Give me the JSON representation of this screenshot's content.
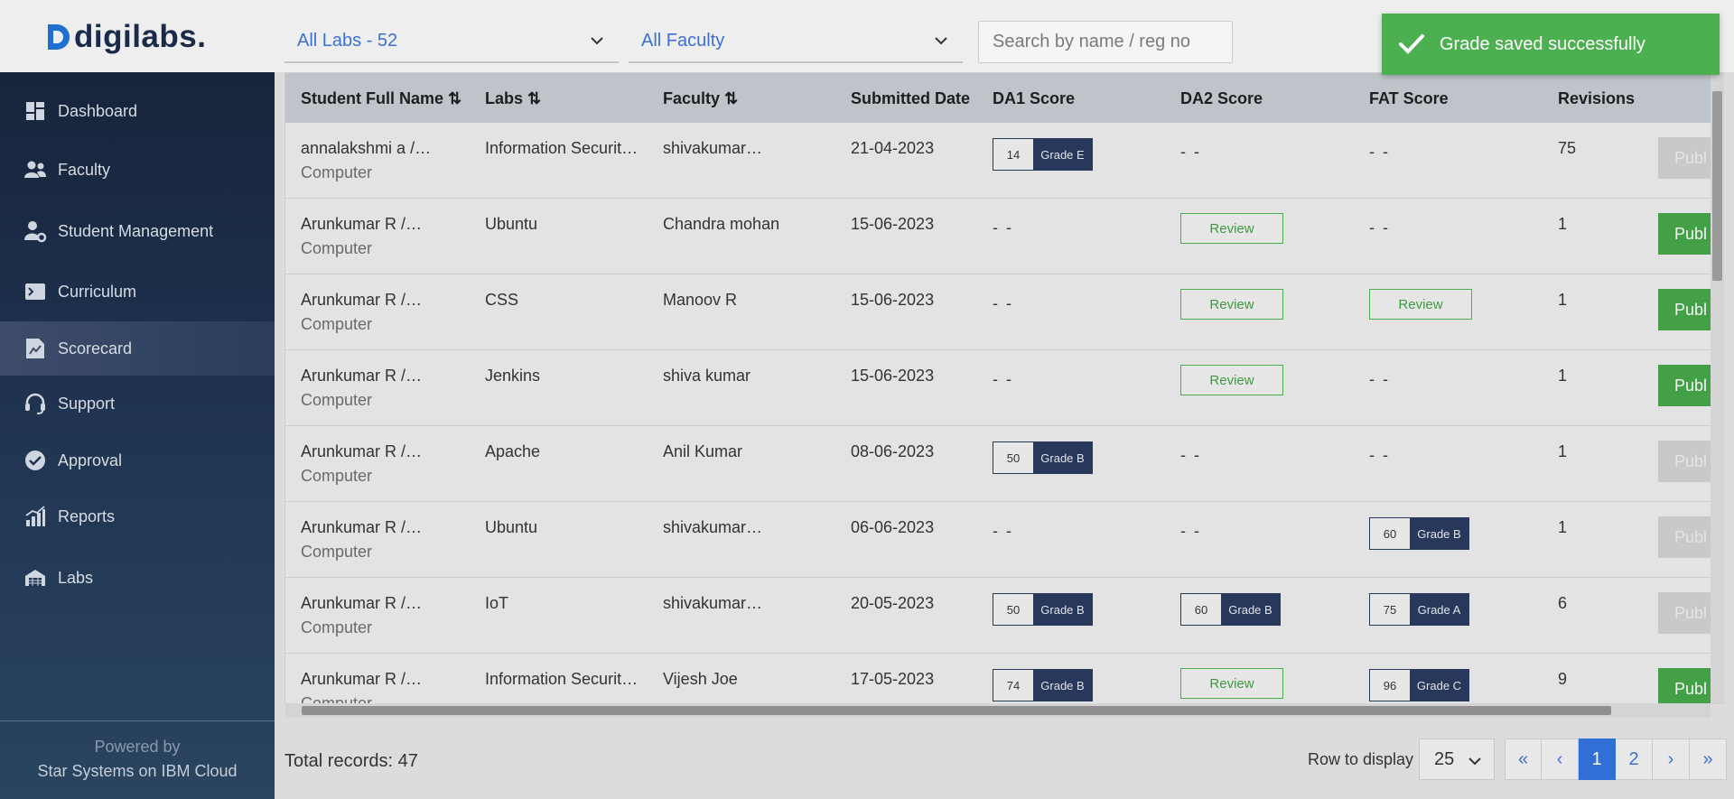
{
  "brand": {
    "name": "digilabs."
  },
  "filters": {
    "labs": "All Labs - 52",
    "faculty": "All Faculty",
    "search_placeholder": "Search by name / reg no"
  },
  "toast": {
    "message": "Grade saved successfully"
  },
  "sidebar": {
    "items": [
      {
        "label": "Dashboard",
        "icon": "dashboard-icon"
      },
      {
        "label": "Faculty",
        "icon": "users-icon"
      },
      {
        "label": "Student Management",
        "icon": "user-gear-icon"
      },
      {
        "label": "Curriculum",
        "icon": "terminal-icon"
      },
      {
        "label": "Scorecard",
        "icon": "scorecard-icon",
        "active": true
      },
      {
        "label": "Support",
        "icon": "headset-icon"
      },
      {
        "label": "Approval",
        "icon": "check-circle-icon"
      },
      {
        "label": "Reports",
        "icon": "bar-chart-icon"
      },
      {
        "label": "Labs",
        "icon": "labs-icon"
      }
    ],
    "powered_by": "Powered by",
    "powered_name": "Star Systems on IBM Cloud"
  },
  "table": {
    "headers": {
      "name": "Student Full Name ⇅",
      "labs": "Labs ⇅",
      "faculty": "Faculty ⇅",
      "date": "Submitted Date",
      "da1": "DA1 Score",
      "da2": "DA2 Score",
      "fat": "FAT Score",
      "revisions": "Revisions"
    },
    "publish_label": "Publ",
    "review_label": "Review",
    "empty_label": "- -",
    "rows": [
      {
        "name": "annalakshmi a /…",
        "dept": "Computer",
        "lab": "Information Securit…",
        "faculty": "shivakumar…",
        "date": "21-04-2023",
        "da1": {
          "kind": "score",
          "num": "14",
          "grade": "Grade E"
        },
        "da2": {
          "kind": "empty"
        },
        "fat": {
          "kind": "empty"
        },
        "revisions": "75",
        "publish": "off"
      },
      {
        "name": "Arunkumar R /…",
        "dept": "Computer",
        "lab": "Ubuntu",
        "faculty": "Chandra mohan",
        "date": "15-06-2023",
        "da1": {
          "kind": "empty"
        },
        "da2": {
          "kind": "review"
        },
        "fat": {
          "kind": "empty"
        },
        "revisions": "1",
        "publish": "on"
      },
      {
        "name": "Arunkumar R /…",
        "dept": "Computer",
        "lab": "CSS",
        "faculty": "Manoov R",
        "date": "15-06-2023",
        "da1": {
          "kind": "empty"
        },
        "da2": {
          "kind": "review"
        },
        "fat": {
          "kind": "review"
        },
        "revisions": "1",
        "publish": "on"
      },
      {
        "name": "Arunkumar R /…",
        "dept": "Computer",
        "lab": "Jenkins",
        "faculty": "shiva kumar",
        "date": "15-06-2023",
        "da1": {
          "kind": "empty"
        },
        "da2": {
          "kind": "review"
        },
        "fat": {
          "kind": "empty"
        },
        "revisions": "1",
        "publish": "on"
      },
      {
        "name": "Arunkumar R /…",
        "dept": "Computer",
        "lab": "Apache",
        "faculty": "Anil Kumar",
        "date": "08-06-2023",
        "da1": {
          "kind": "score",
          "num": "50",
          "grade": "Grade B"
        },
        "da2": {
          "kind": "empty"
        },
        "fat": {
          "kind": "empty"
        },
        "revisions": "1",
        "publish": "off"
      },
      {
        "name": "Arunkumar R /…",
        "dept": "Computer",
        "lab": "Ubuntu",
        "faculty": "shivakumar…",
        "date": "06-06-2023",
        "da1": {
          "kind": "empty"
        },
        "da2": {
          "kind": "empty"
        },
        "fat": {
          "kind": "score",
          "num": "60",
          "grade": "Grade B"
        },
        "revisions": "1",
        "publish": "off"
      },
      {
        "name": "Arunkumar R /…",
        "dept": "Computer",
        "lab": "IoT",
        "faculty": "shivakumar…",
        "date": "20-05-2023",
        "da1": {
          "kind": "score",
          "num": "50",
          "grade": "Grade B"
        },
        "da2": {
          "kind": "score",
          "num": "60",
          "grade": "Grade B"
        },
        "fat": {
          "kind": "score",
          "num": "75",
          "grade": "Grade A"
        },
        "revisions": "6",
        "publish": "off"
      },
      {
        "name": "Arunkumar R /…",
        "dept": "Computer",
        "lab": "Information Securit…",
        "faculty": "Vijesh Joe",
        "date": "17-05-2023",
        "da1": {
          "kind": "score",
          "num": "74",
          "grade": "Grade B"
        },
        "da2": {
          "kind": "review"
        },
        "fat": {
          "kind": "score",
          "num": "96",
          "grade": "Grade C"
        },
        "revisions": "9",
        "publish": "on"
      }
    ]
  },
  "footer": {
    "total": "Total records: 47",
    "rows_label": "Row to display",
    "rows_value": "25",
    "pages": [
      "«",
      "‹",
      "1",
      "2",
      "›",
      "»"
    ],
    "active_page": "1"
  }
}
